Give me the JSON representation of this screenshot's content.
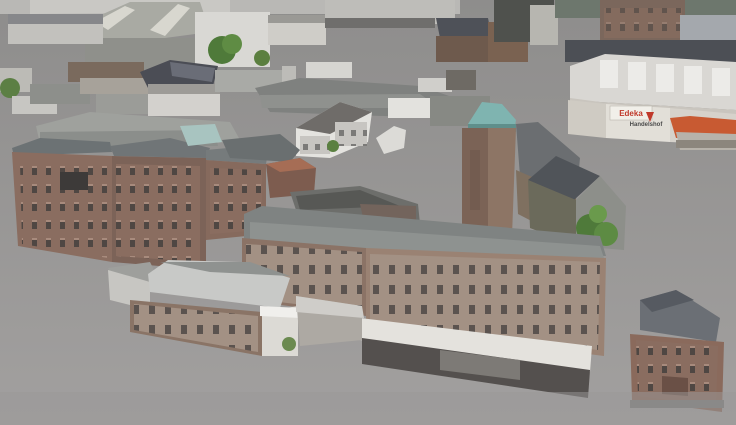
{
  "view": {
    "mode": "3D aerial view",
    "ground_color": "#9e9c9b"
  },
  "signs": {
    "storefront_sign": "Edeka",
    "storefront_sub": "Handelshof"
  },
  "colors": {
    "brick": "#8a6d60",
    "brick_dark": "#6f564b",
    "roof_gray": "#7d8080",
    "roof_light": "#c4c4c2",
    "warehouse": "#dcdad6",
    "tower_roof": "#7fb4b0",
    "tree": "#4f7a3a",
    "accent_red": "#c0392b"
  }
}
